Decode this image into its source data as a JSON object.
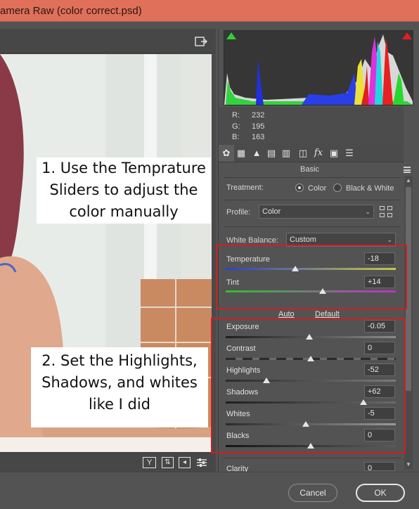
{
  "window": {
    "title": "amera Raw (color correct.psd)"
  },
  "readout": {
    "r_label": "R:",
    "r_value": "232",
    "g_label": "G:",
    "g_value": "195",
    "b_label": "B:",
    "b_value": "163"
  },
  "panel": {
    "title": "Basic",
    "tab_icons": [
      "aperture-icon",
      "grid-icon",
      "mountains-icon",
      "split-tone-icon",
      "hsl-icon",
      "lens-icon",
      "fx-icon",
      "camera-icon",
      "presets-icon"
    ]
  },
  "treatment": {
    "label": "Treatment:",
    "option_color": "Color",
    "option_bw": "Black & White",
    "selected": "Color"
  },
  "profile": {
    "label": "Profile:",
    "value": "Color"
  },
  "white_balance": {
    "label": "White Balance:",
    "value": "Custom"
  },
  "sliders": {
    "temperature": {
      "label": "Temperature",
      "value": "-18",
      "position": 0.41
    },
    "tint": {
      "label": "Tint",
      "value": "+14",
      "position": 0.57
    },
    "exposure": {
      "label": "Exposure",
      "value": "-0.05",
      "position": 0.49
    },
    "contrast": {
      "label": "Contrast",
      "value": "0",
      "position": 0.5
    },
    "highlights": {
      "label": "Highlights",
      "value": "-52",
      "position": 0.24
    },
    "shadows": {
      "label": "Shadows",
      "value": "+62",
      "position": 0.81
    },
    "whites": {
      "label": "Whites",
      "value": "-5",
      "position": 0.47
    },
    "blacks": {
      "label": "Blacks",
      "value": "0",
      "position": 0.5
    },
    "clarity": {
      "label": "Clarity",
      "value": "0"
    }
  },
  "links": {
    "auto": "Auto",
    "default": "Default"
  },
  "annotations": {
    "one_line1": "1. Use the Temprature",
    "one_line2": "Sliders to adjust the",
    "one_line3": "color manually",
    "two_line1": "2. Set the Highlights,",
    "two_line2": "Shadows, and whites",
    "two_line3": "like I did"
  },
  "buttons": {
    "cancel": "Cancel",
    "ok": "OK"
  },
  "colors": {
    "title_bar": "#e0705a",
    "annotation_box": "#d11e1e",
    "panel_bg": "#535353"
  }
}
